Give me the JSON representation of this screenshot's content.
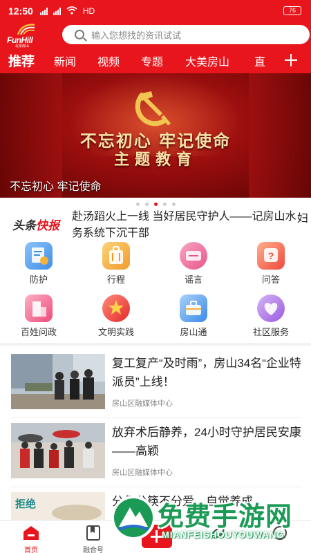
{
  "status_bar": {
    "time": "12:50",
    "network": "HD",
    "battery": "76"
  },
  "header": {
    "logo_text": "FunHill",
    "logo_sub": "北京房山",
    "search_placeholder": "输入您想找的资讯试试"
  },
  "tabs": [
    "推荐",
    "新闻",
    "视频",
    "专题",
    "大美房山",
    "直"
  ],
  "banner": {
    "slogan_line1": "不忘初心 牢记使命",
    "slogan_line2": "主题教育",
    "caption": "不忘初心 牢记使命",
    "dots": 5,
    "active_dot": 3
  },
  "headline": {
    "badge_part1": "头条",
    "badge_part2": "快报",
    "text": "赴汤蹈火上一线 当好居民守护人——记房山水务系统下沉干部",
    "next_fragment": "妇"
  },
  "quick_links": [
    {
      "label": "防护",
      "icon": "shield-doc-icon",
      "color": "#5aa0ec"
    },
    {
      "label": "行程",
      "icon": "luggage-icon",
      "color": "#f4b23a"
    },
    {
      "label": "谣言",
      "icon": "rumor-icon",
      "color": "#f06a9a"
    },
    {
      "label": "问答",
      "icon": "question-icon",
      "color": "#f0604a"
    },
    {
      "label": "百姓问政",
      "icon": "building-icon",
      "color": "#f06a8a"
    },
    {
      "label": "文明实践",
      "icon": "star-icon",
      "color": "#ef4a44"
    },
    {
      "label": "房山通",
      "icon": "briefcase-icon",
      "color": "#4a9ef0"
    },
    {
      "label": "社区服务",
      "icon": "heart-icon",
      "color": "#a674e0"
    }
  ],
  "news": [
    {
      "title": "复工复产“及时雨”，房山34名“企业特派员”上线！",
      "source": "房山区融媒体中心"
    },
    {
      "title": "放弃术后静养，24小时守护居民安康——高颖",
      "source": "房山区融媒体中心"
    },
    {
      "title": "分餐分筷不分爱，自觉养成",
      "source": "",
      "thumb_text": "拒绝"
    }
  ],
  "bottom_nav": [
    {
      "label": "首页",
      "icon": "home-icon",
      "active": true
    },
    {
      "label": "融合号",
      "icon": "bookmark-icon",
      "active": false
    },
    {
      "label": "",
      "icon": "plus-icon",
      "active": false
    },
    {
      "label": "",
      "icon": "leaf-icon",
      "active": false
    },
    {
      "label": "",
      "icon": "profile-icon",
      "active": false
    }
  ],
  "watermark": {
    "text": "免费手游网",
    "sub": "MIANFEISHOUYOUWANG"
  },
  "colors": {
    "brand": "#e8151d",
    "watermark": "#1a9a55"
  }
}
